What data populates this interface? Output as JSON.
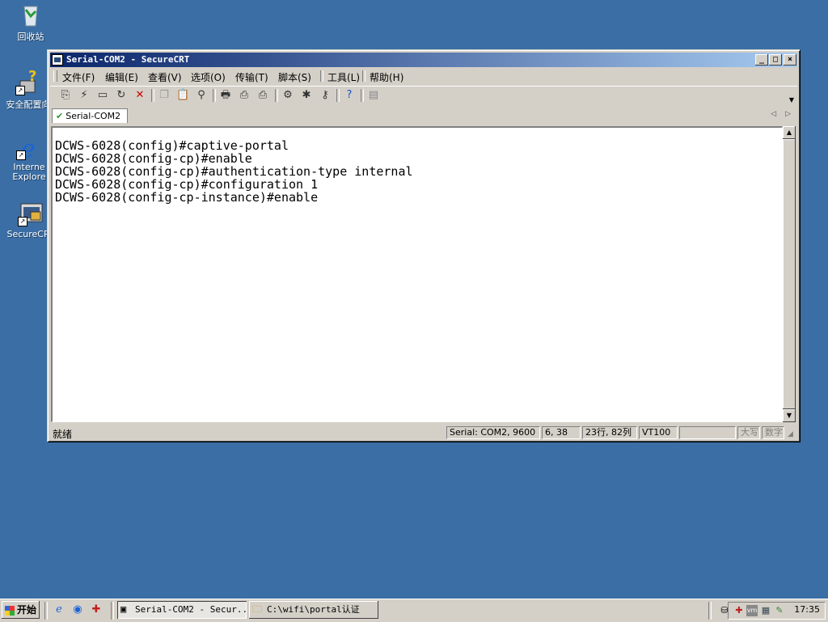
{
  "desktop": {
    "icons": [
      {
        "label": "回收站",
        "icon": "recycle-bin-icon"
      },
      {
        "label": "安全配置向",
        "icon": "security-config-icon"
      },
      {
        "label": "Interne\nExplore",
        "icon": "internet-explorer-icon"
      },
      {
        "label": "SecureCRT",
        "icon": "securecrt-icon"
      }
    ]
  },
  "window": {
    "title": "Serial-COM2 - SecureCRT",
    "controls": {
      "minimize": "_",
      "maximize": "□",
      "close": "×"
    }
  },
  "menu": {
    "items": [
      "文件(F)",
      "编辑(E)",
      "查看(V)",
      "选项(O)",
      "传输(T)",
      "脚本(S)",
      "工具(L)",
      "帮助(H)"
    ]
  },
  "toolbar": {
    "icons": [
      "connect-icon",
      "quick-connect-icon",
      "connect-tab-icon",
      "reconnect-icon",
      "disconnect-icon",
      "copy-icon",
      "paste-icon",
      "find-icon",
      "print-screen-icon",
      "print-selection-icon",
      "print-icon",
      "session-options-icon",
      "global-options-icon",
      "keymap-icon",
      "help-icon",
      "log-icon"
    ]
  },
  "tabs": [
    {
      "label": "Serial-COM2",
      "active": true
    }
  ],
  "terminal": {
    "lines": [
      "DCWS-6028(config)#captive-portal",
      "DCWS-6028(config-cp)#enable",
      "DCWS-6028(config-cp)#authentication-type internal",
      "DCWS-6028(config-cp)#configuration 1",
      "DCWS-6028(config-cp-instance)#enable"
    ]
  },
  "status": {
    "ready": "就绪",
    "connection": "Serial: COM2, 9600",
    "cursor": "6, 38",
    "size": "23行, 82列",
    "emulation": "VT100",
    "blank": "",
    "caps": "大写",
    "num": "数字"
  },
  "taskbar": {
    "start": "开始",
    "tasks": [
      {
        "label": "Serial-COM2 - Secur...",
        "active": true,
        "icon": "securecrt-icon"
      },
      {
        "label": "C:\\wifi\\portal认证",
        "active": false,
        "icon": "folder-icon"
      }
    ],
    "clock": "17:35"
  }
}
